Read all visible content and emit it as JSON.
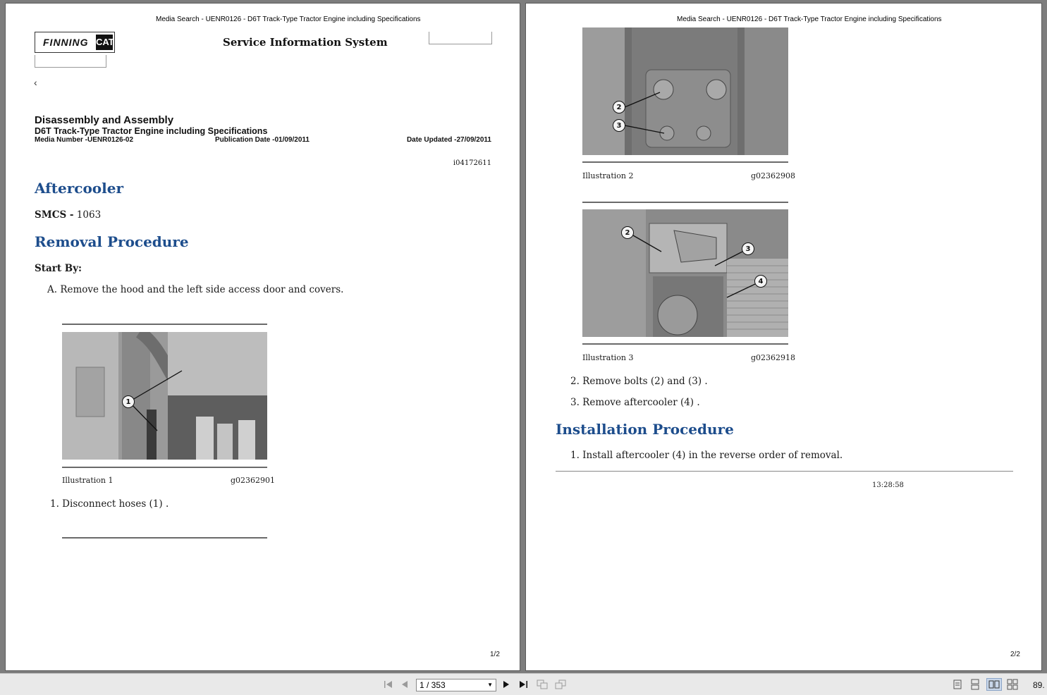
{
  "page1": {
    "header": "Media Search - UENR0126 - D6T Track-Type Tractor Engine including Specifications",
    "logo": {
      "finning": "FINNING",
      "cat": "CAT"
    },
    "sis_title": "Service Information System",
    "back_arrow": "‹",
    "doc_title": "Disassembly and Assembly",
    "doc_subtitle": "D6T Track-Type Tractor Engine including Specifications",
    "media_number": "Media Number -UENR0126-02",
    "publication_date": "Publication Date -01/09/2011",
    "date_updated": "Date Updated -27/09/2011",
    "doc_id": "i04172611",
    "heading_aftercooler": "Aftercooler",
    "smcs_label": "SMCS -",
    "smcs_value": "1063",
    "heading_removal": "Removal Procedure",
    "start_by": "Start By:",
    "step_a": "A. Remove the hood and the left side access door and covers.",
    "illustration1": {
      "label": "Illustration 1",
      "id": "g02362901",
      "callouts": [
        "1"
      ]
    },
    "step_1": "1. Disconnect hoses (1) .",
    "page_num": "1/2"
  },
  "page2": {
    "header": "Media Search - UENR0126 - D6T Track-Type Tractor Engine including Specifications",
    "illustration2": {
      "label": "Illustration 2",
      "id": "g02362908",
      "callouts": [
        "2",
        "3"
      ]
    },
    "illustration3": {
      "label": "Illustration 3",
      "id": "g02362918",
      "callouts": [
        "2",
        "3",
        "4"
      ]
    },
    "step_2": "2. Remove bolts (2) and (3) .",
    "step_3": "3. Remove aftercooler (4) .",
    "heading_install": "Installation Procedure",
    "install_step_1": "1. Install aftercooler (4) in the reverse order of removal.",
    "timestamp": "13:28:58",
    "page_num": "2/2"
  },
  "toolbar": {
    "page_indicator": "1 / 353",
    "zoom": "89.",
    "icons": [
      "first-page-icon",
      "prev-page-icon",
      "next-page-icon",
      "last-page-icon",
      "copy-icon",
      "rotate-icon",
      "single-page-icon",
      "continuous-icon",
      "two-page-icon",
      "two-page-continuous-icon"
    ]
  }
}
